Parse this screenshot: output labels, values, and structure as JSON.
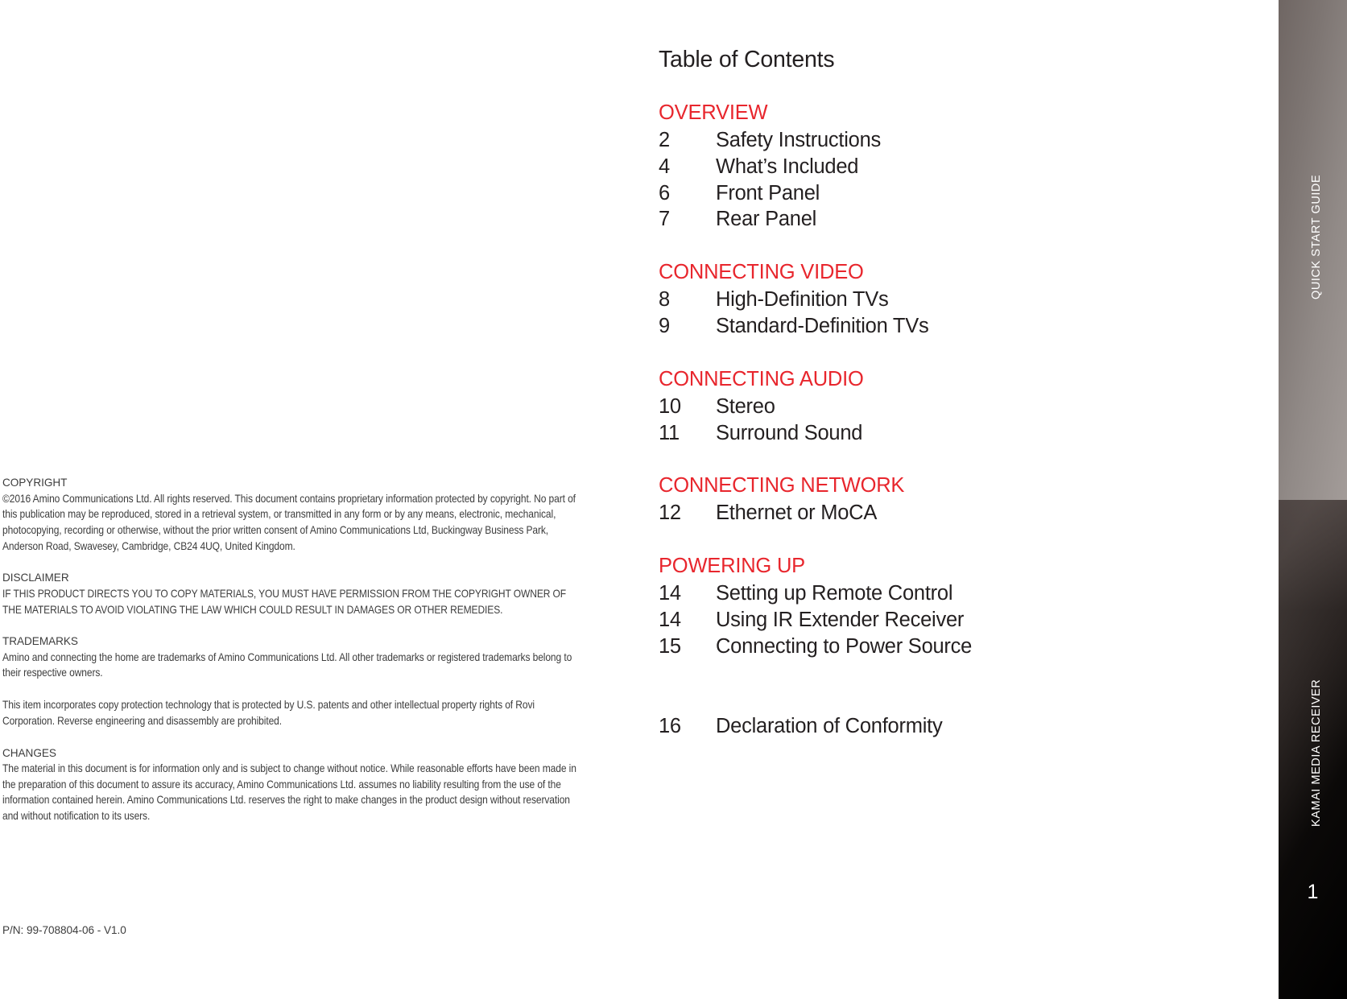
{
  "document": {
    "page_number": "1",
    "side_tab_upper_label": "QUICK START GUIDE",
    "side_tab_lower_label": "KAMAI MEDIA RECEIVER",
    "accent_color": "#E8262D",
    "text_color": "#231f20",
    "legal_text_color": "#3d3d3d"
  },
  "toc": {
    "title": "Table of Contents",
    "sections": [
      {
        "heading": "OVERVIEW",
        "entries": [
          {
            "page": "2",
            "label": "Safety Instructions"
          },
          {
            "page": "4",
            "label": "What’s Included"
          },
          {
            "page": "6",
            "label": "Front Panel"
          },
          {
            "page": "7",
            "label": "Rear Panel"
          }
        ]
      },
      {
        "heading": "CONNECTING VIDEO",
        "entries": [
          {
            "page": "8",
            "label": "High-Definition TVs"
          },
          {
            "page": "9",
            "label": "Standard-Definition TVs"
          }
        ]
      },
      {
        "heading": "CONNECTING AUDIO",
        "entries": [
          {
            "page": "10",
            "label": "Stereo"
          },
          {
            "page": "11",
            "label": "Surround Sound"
          }
        ]
      },
      {
        "heading": "CONNECTING NETWORK",
        "entries": [
          {
            "page": "12",
            "label": "Ethernet or MoCA"
          }
        ]
      },
      {
        "heading": "POWERING UP",
        "entries": [
          {
            "page": "14",
            "label": "Setting up Remote Control"
          },
          {
            "page": "14",
            "label": "Using IR Extender Receiver"
          },
          {
            "page": "15",
            "label": "Connecting to Power Source"
          }
        ]
      }
    ],
    "standalone_entry": {
      "page": "16",
      "label": "Declaration of Conformity"
    }
  },
  "legal": {
    "copyright": {
      "heading": "COPYRIGHT",
      "body": "©2016 Amino Communications Ltd. All rights reserved. This document contains proprietary information protected by copyright. No part of this publication may be reproduced, stored in a retrieval system, or transmitted in any form or by any means, electronic, mechanical, photocopying, recording or otherwise, without the prior written consent of Amino Communications Ltd, Buckingway Business Park, Anderson Road, Swavesey, Cambridge, CB24 4UQ, United Kingdom."
    },
    "disclaimer": {
      "heading": "DISCLAIMER",
      "body": "IF THIS PRODUCT DIRECTS YOU TO COPY MATERIALS, YOU MUST HAVE PERMISSION FROM THE COPYRIGHT OWNER OF THE MATERIALS TO AVOID VIOLATING THE LAW WHICH COULD RESULT IN DAMAGES OR OTHER REMEDIES."
    },
    "trademarks": {
      "heading": "TRADEMARKS",
      "body": "Amino and connecting the home are trademarks of Amino Communications Ltd. All other trademarks or registered trademarks belong to their respective owners."
    },
    "copy_protection": {
      "body": "This item incorporates copy protection technology that is protected by U.S. patents and other intellectual property rights of Rovi Corporation. Reverse engineering and disassembly are prohibited."
    },
    "changes": {
      "heading": "CHANGES",
      "body": "The material in this document is for information only and is subject to change without notice. While reasonable efforts have been made in the preparation of this document to assure its accuracy, Amino Communications Ltd. assumes no liability resulting from the use of the information contained herein. Amino Communications Ltd. reserves the right to make changes in the product design without reservation and without notification to its users."
    },
    "part_number": "P/N: 99-708804-06 - V1.0"
  }
}
